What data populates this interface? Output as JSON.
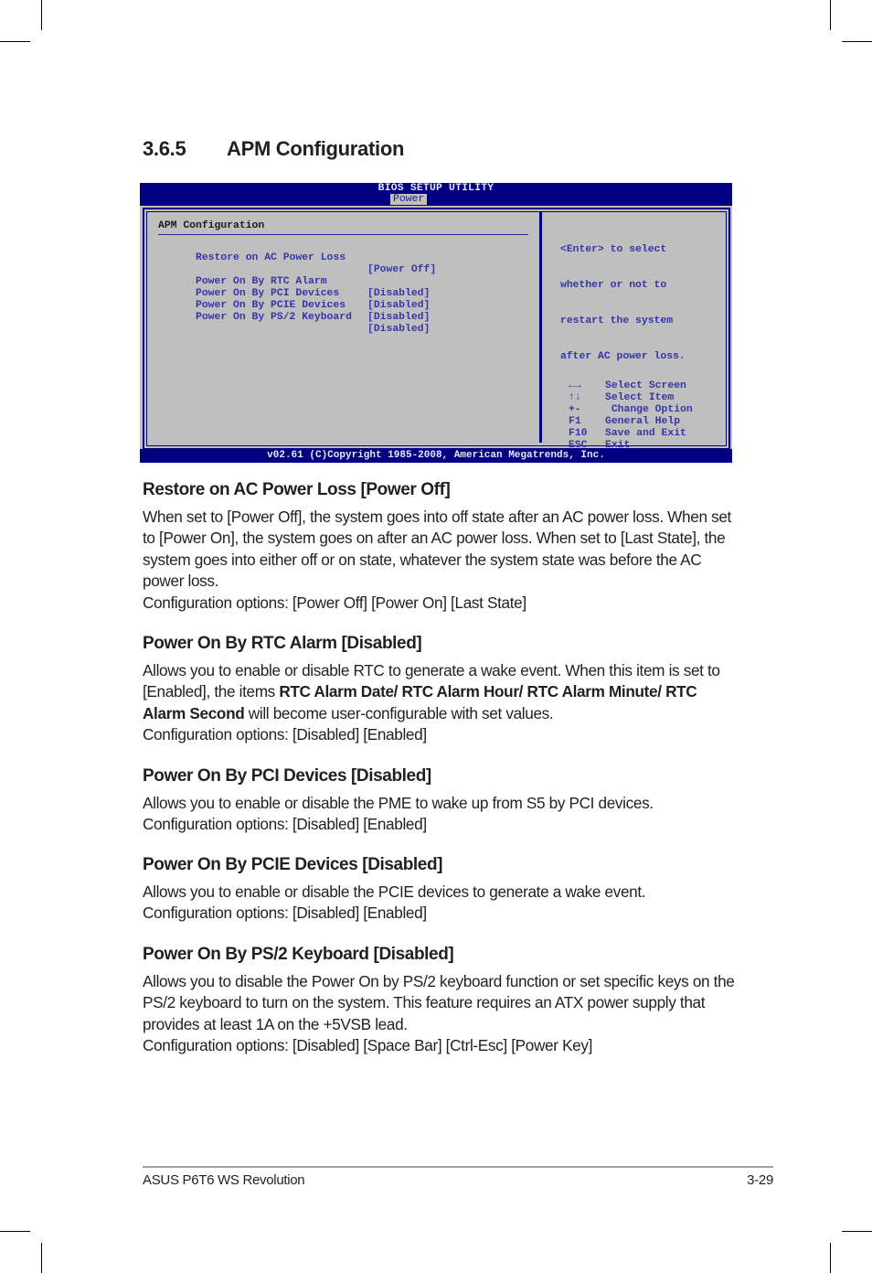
{
  "section": {
    "number": "3.6.5",
    "title": "APM Configuration"
  },
  "bios": {
    "title": "BIOS SETUP UTILITY",
    "active_tab": "Power",
    "heading": "APM Configuration",
    "items": [
      {
        "label": "Restore on AC Power Loss",
        "value": "[Power Off]"
      },
      {
        "label": "Power On By RTC Alarm",
        "value": "[Disabled]"
      },
      {
        "label": "Power On By PCI Devices",
        "value": "[Disabled]"
      },
      {
        "label": "Power On By PCIE Devices",
        "value": "[Disabled]"
      },
      {
        "label": "Power On By PS/2 Keyboard",
        "value": "[Disabled]"
      }
    ],
    "help_lines": [
      "<Enter> to select",
      "whether or not to",
      "restart the system",
      "after AC power loss."
    ],
    "keys": [
      {
        "key": "←→",
        "icon": "left-right-arrows-icon",
        "desc": "Select Screen"
      },
      {
        "key": "↑↓",
        "icon": "up-down-arrows-icon",
        "desc": "Select Item"
      },
      {
        "key": "+-",
        "icon": "plus-minus-icon",
        "desc": " Change Option"
      },
      {
        "key": "F1",
        "desc": "General Help"
      },
      {
        "key": "F10",
        "desc": "Save and Exit"
      },
      {
        "key": "ESC",
        "desc": "Exit"
      }
    ],
    "footer": "v02.61 (C)Copyright 1985-2008, American Megatrends, Inc.",
    "colors": {
      "bar": "#000080",
      "panel": "#bfbfbf",
      "text": "#3535a8"
    }
  },
  "items": [
    {
      "heading": "Restore on AC Power Loss [Power Off]",
      "body": [
        {
          "t": "When set to [Power Off], the system goes into off state after an AC power loss. When set to [Power On], the system goes on after an AC power loss. When set to [Last State], the system goes into either off or on state, whatever the system state was before the AC power loss."
        }
      ],
      "options": "Configuration options: [Power Off] [Power On] [Last State]"
    },
    {
      "heading": "Power On By RTC Alarm [Disabled]",
      "body": [
        {
          "t": "Allows you to enable or disable RTC to generate a wake event. When this item is set to [Enabled], the items "
        },
        {
          "t": "RTC Alarm Date/ RTC Alarm Hour/ RTC Alarm Minute/ RTC Alarm Second",
          "b": true
        },
        {
          "t": " will become user-configurable with set values."
        }
      ],
      "options": "Configuration options: [Disabled] [Enabled]"
    },
    {
      "heading": "Power On By PCI Devices [Disabled]",
      "body": [
        {
          "t": "Allows you to enable or disable the PME to wake up from S5 by PCI devices."
        }
      ],
      "options": "Configuration options: [Disabled] [Enabled]"
    },
    {
      "heading": "Power On By PCIE Devices [Disabled]",
      "body": [
        {
          "t": "Allows you to enable or disable the PCIE devices to generate a wake event."
        }
      ],
      "options": "Configuration options: [Disabled] [Enabled]"
    },
    {
      "heading": "Power On By PS/2 Keyboard [Disabled]",
      "body": [
        {
          "t": "Allows you to disable the Power On by PS/2 keyboard function or set specific keys on the PS/2 keyboard to turn on the system. This feature requires an ATX power supply that provides at least 1A on the +5VSB lead."
        }
      ],
      "options": "Configuration options: [Disabled] [Space Bar] [Ctrl-Esc] [Power Key]"
    }
  ],
  "footer": {
    "product": "ASUS P6T6 WS Revolution",
    "page": "3-29"
  }
}
